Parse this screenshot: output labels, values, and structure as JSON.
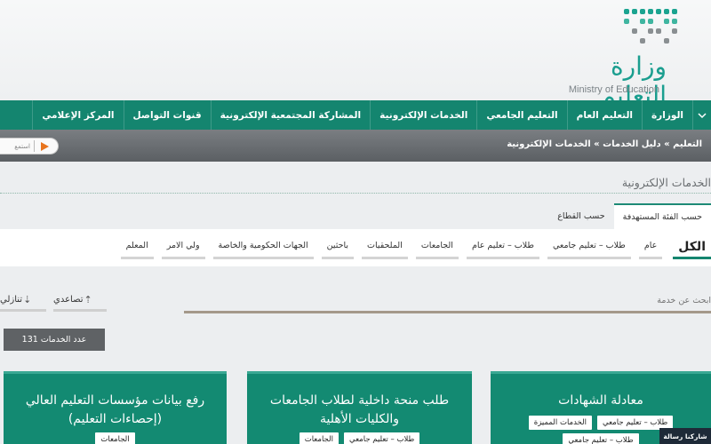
{
  "logo": {
    "name_ar": "وزارة التعليم",
    "name_en": "Ministry of Education"
  },
  "nav": {
    "items": [
      "الوزارة",
      "التعليم العام",
      "التعليم الجامعي",
      "الخدمات الإلكترونية",
      "المشاركة المجتمعية الإلكترونية",
      "قنوات التواصل",
      "المركز الإعلامي"
    ]
  },
  "breadcrumb": {
    "text": "التعليم » دليل الخدمات » الخدمات الإلكترونية"
  },
  "listen": {
    "label": "استمع"
  },
  "section": {
    "title": "الخدمات الإلكترونية"
  },
  "tabs": {
    "items": [
      "حسب الفئة المستهدفة",
      "حسب القطاع"
    ]
  },
  "filters": {
    "items": [
      "الكل",
      "عام",
      "طلاب – تعليم جامعي",
      "طلاب – تعليم عام",
      "الجامعات",
      "الملحقيات",
      "باحثين",
      "الجهات الحكومية والخاصة",
      "ولي الامر",
      "المعلم"
    ]
  },
  "sort": {
    "asc": "تصاعدي",
    "desc": "تنازلي"
  },
  "search": {
    "placeholder": "ابحث عن خدمة"
  },
  "count": {
    "label": "عدد الخدمات 131"
  },
  "cards": [
    {
      "title": "معادلة الشهادات",
      "tags": [
        "طلاب – تعليم جامعي",
        "الخدمات المميزة",
        "طلاب – تعليم جامعي"
      ]
    },
    {
      "title_line1": "طلب منحة داخلية لطلاب الجامعات",
      "title_line2": "والكليات الأهلية",
      "tags": [
        "طلاب – تعليم جامعي",
        "الجامعات"
      ]
    },
    {
      "title_line1": "رفع بيانات مؤسسات التعليم العالي",
      "title_line2": "(إحصاءات التعليم)",
      "tags": [
        "الجامعات"
      ]
    }
  ],
  "chat": {
    "label": "شاركنا رسالة"
  },
  "colors": {
    "brand_green": "#14856f",
    "card_green": "#138a72",
    "play_orange": "#e8741e"
  }
}
